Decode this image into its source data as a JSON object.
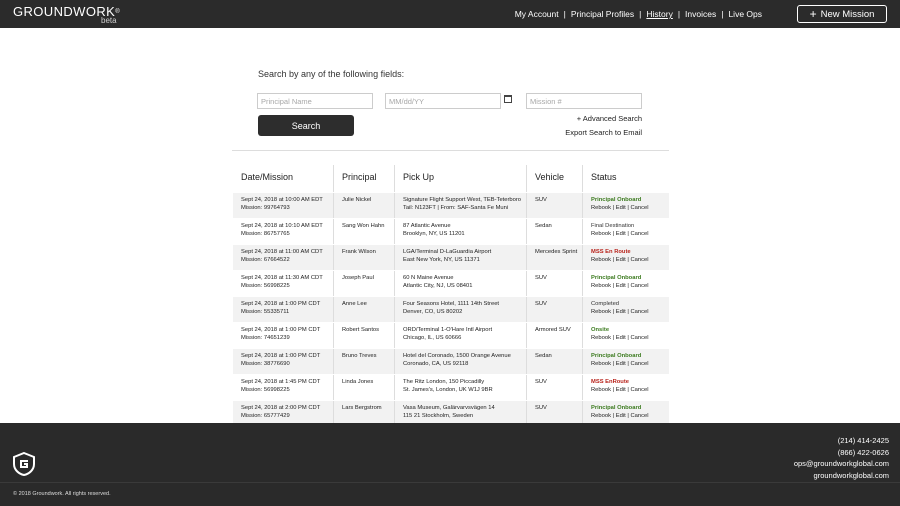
{
  "header": {
    "logo": "GROUNDWORK",
    "logo_mark": "®",
    "beta": "beta",
    "nav": [
      {
        "label": "My Account"
      },
      {
        "label": "Principal Profiles"
      },
      {
        "label": "History"
      },
      {
        "label": "Invoices"
      },
      {
        "label": "Live Ops"
      }
    ],
    "new_mission": "New Mission"
  },
  "search": {
    "title": "Search by any of the following fields:",
    "principal_placeholder": "Principal Name",
    "date_placeholder": "MM/dd/YY",
    "mission_placeholder": "Mission #",
    "button": "Search",
    "advanced": "+ Advanced Search",
    "export": "Export Search to Email"
  },
  "table": {
    "headers": [
      "Date/Mission",
      "Principal",
      "Pick Up",
      "Vehicle",
      "Status"
    ],
    "actions": {
      "rebook": "Rebook",
      "edit": "Edit",
      "cancel": "Cancel"
    },
    "rows": [
      {
        "date": "Sept 24, 2018 at 10:00 AM EDT",
        "mission": "Mission: 99764793",
        "principal": "Julie Nickel",
        "pickup1": "Signature Flight Support West, TEB-Teterboro",
        "pickup2": "Tail: N123FT | From: SAF-Santa Fe Muni",
        "vehicle": "SUV",
        "status": "Principal Onboard",
        "status_color": "green"
      },
      {
        "date": "Sept 24, 2018 at 10:10 AM EDT",
        "mission": "Mission: 86757765",
        "principal": "Sang Won Hahn",
        "pickup1": "87 Atlantic Avenue",
        "pickup2": "Brooklyn, NY, US 11201",
        "vehicle": "Sedan",
        "status": "Final Destination",
        "status_color": "plain"
      },
      {
        "date": "Sept 24, 2018 at 11:00 AM CDT",
        "mission": "Mission: 67664522",
        "principal": "Frank Wilson",
        "pickup1": "LGA/Terminal D-LaGuardia Airport",
        "pickup2": "East New York, NY, US 11371",
        "vehicle": "Mercedes Sprint",
        "status": "MSS En Route",
        "status_color": "red"
      },
      {
        "date": "Sept 24, 2018 at 11:30 AM CDT",
        "mission": "Mission: 56998225",
        "principal": "Joseph Paul",
        "pickup1": "60 N Maine Avenue",
        "pickup2": "Atlantic City, NJ, US 08401",
        "vehicle": "SUV",
        "status": "Principal Onboard",
        "status_color": "green"
      },
      {
        "date": "Sept 24, 2018 at 1:00 PM CDT",
        "mission": "Mission: 55335711",
        "principal": "Anne Lee",
        "pickup1": "Four Seasons Hotel, 1111 14th Street",
        "pickup2": "Denver, CO, US 80202",
        "vehicle": "SUV",
        "status": "Completed",
        "status_color": "plain"
      },
      {
        "date": "Sept 24, 2018 at 1:00 PM CDT",
        "mission": "Mission: 74651239",
        "principal": "Robert Santos",
        "pickup1": "ORD/Terminal 1-O'Hare Intl Airport",
        "pickup2": "Chicago, IL, US 60666",
        "vehicle": "Armored SUV",
        "status": "Onsite",
        "status_color": "green"
      },
      {
        "date": "Sept 24, 2018 at 1:00 PM CDT",
        "mission": "Mission: 38776690",
        "principal": "Bruno Treves",
        "pickup1": "Hotel del Coronado, 1500 Orange Avenue",
        "pickup2": "Coronado, CA, US 92118",
        "vehicle": "Sedan",
        "status": "Principal Onboard",
        "status_color": "green"
      },
      {
        "date": "Sept 24, 2018 at 1:45 PM CDT",
        "mission": "Mission: 56998225",
        "principal": "Linda Jones",
        "pickup1": "The Ritz London, 150 Piccadilly",
        "pickup2": "St. James's, London, UK W1J 9BR",
        "vehicle": "SUV",
        "status": "MSS EnRoute",
        "status_color": "red"
      },
      {
        "date": "Sept 24, 2018 at 2:00 PM CDT",
        "mission": "Mission: 65777429",
        "principal": "Lars Bergstrom",
        "pickup1": "Vasa Museum, Galärvarvsvägen 14",
        "pickup2": "115 21 Stockholm, Sweden",
        "vehicle": "SUV",
        "status": "Principal Onboard",
        "status_color": "green"
      }
    ]
  },
  "footer": {
    "phone1": "(214) 414-2425",
    "phone2": "(866) 422-0626",
    "email": "ops@groundworkglobal.com",
    "website": "groundworkglobal.com",
    "copyright": "© 2018 Groundwork. All rights reserved."
  },
  "colors": {
    "header_bg": "#2b2b2b",
    "status_green": "#3b7a1e",
    "status_red": "#b8231b"
  }
}
